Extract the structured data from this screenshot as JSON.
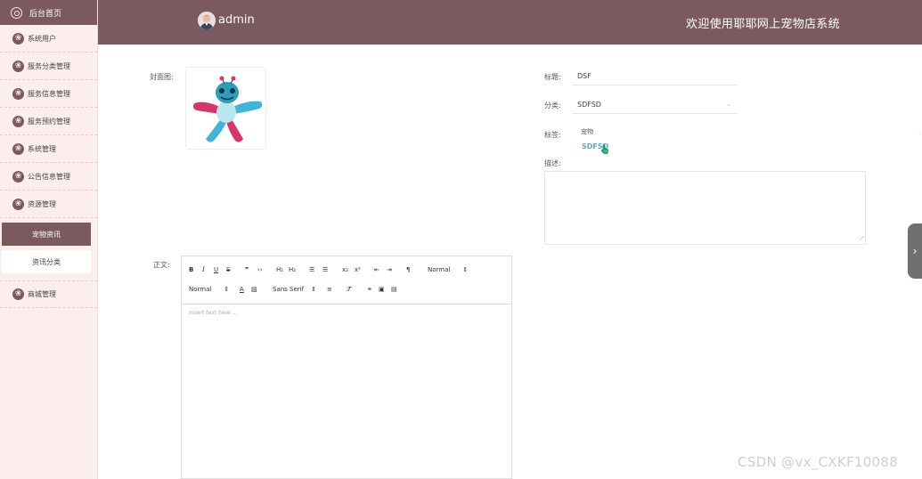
{
  "header": {
    "user_name": "admin",
    "welcome": "欢迎使用耶耶网上宠物店系统"
  },
  "sidebar": {
    "home_label": "后台首页",
    "items": [
      {
        "label": "系统用户"
      },
      {
        "label": "服务分类管理"
      },
      {
        "label": "服务信息管理"
      },
      {
        "label": "服务预约管理"
      },
      {
        "label": "系统管理"
      },
      {
        "label": "公告信息管理"
      },
      {
        "label": "资源管理"
      }
    ],
    "sub_items": [
      {
        "label": "宠物资讯",
        "active": true
      },
      {
        "label": "资讯分类",
        "active": false
      }
    ],
    "last_item": {
      "label": "商城管理"
    }
  },
  "form": {
    "cover_label": "封面图:",
    "title_label": "标题:",
    "title_value": "DSF",
    "category_label": "分类:",
    "category_value": "SDFSD",
    "tag_label": "标签:",
    "tag_title": "宠物",
    "tag_chip": "SDFSD",
    "desc_label": "描述:",
    "body_label": "正文:"
  },
  "editor": {
    "header_select": "Normal",
    "size_select": "Normal",
    "font_select": "Sans Serif",
    "placeholder": "Insert text here ..."
  },
  "watermark": "CSDN @vx_CXKF10088",
  "colors": {
    "brand": "#7a5a5f",
    "sidebar_bg": "#fdeeee",
    "tag_accent": "#5aaccf"
  }
}
